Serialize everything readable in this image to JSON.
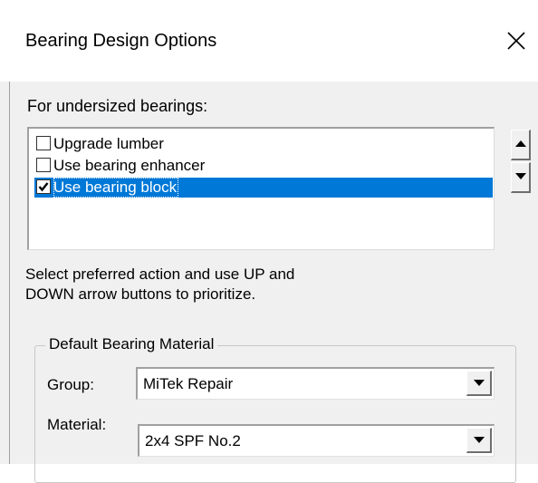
{
  "window": {
    "title": "Bearing Design Options",
    "close_icon": "close-icon"
  },
  "undersized": {
    "label": "For undersized bearings:",
    "items": [
      {
        "label": "Upgrade lumber",
        "checked": false,
        "selected": false
      },
      {
        "label": "Use bearing enhancer",
        "checked": false,
        "selected": false
      },
      {
        "label": "Use bearing block",
        "checked": true,
        "selected": true
      }
    ],
    "up_icon": "arrow-up-icon",
    "down_icon": "arrow-down-icon"
  },
  "hint": {
    "line1": "Select preferred action and use UP and",
    "line2": "DOWN arrow buttons to prioritize."
  },
  "default_material": {
    "legend": "Default Bearing Material",
    "group_label": "Group:",
    "group_value": "MiTek Repair",
    "material_label": "Material:",
    "material_value": "2x4 SPF No.2"
  },
  "colors": {
    "selection": "#0078d7",
    "dialog_bg": "#f0f0f0",
    "title_bg": "#ffffff"
  }
}
